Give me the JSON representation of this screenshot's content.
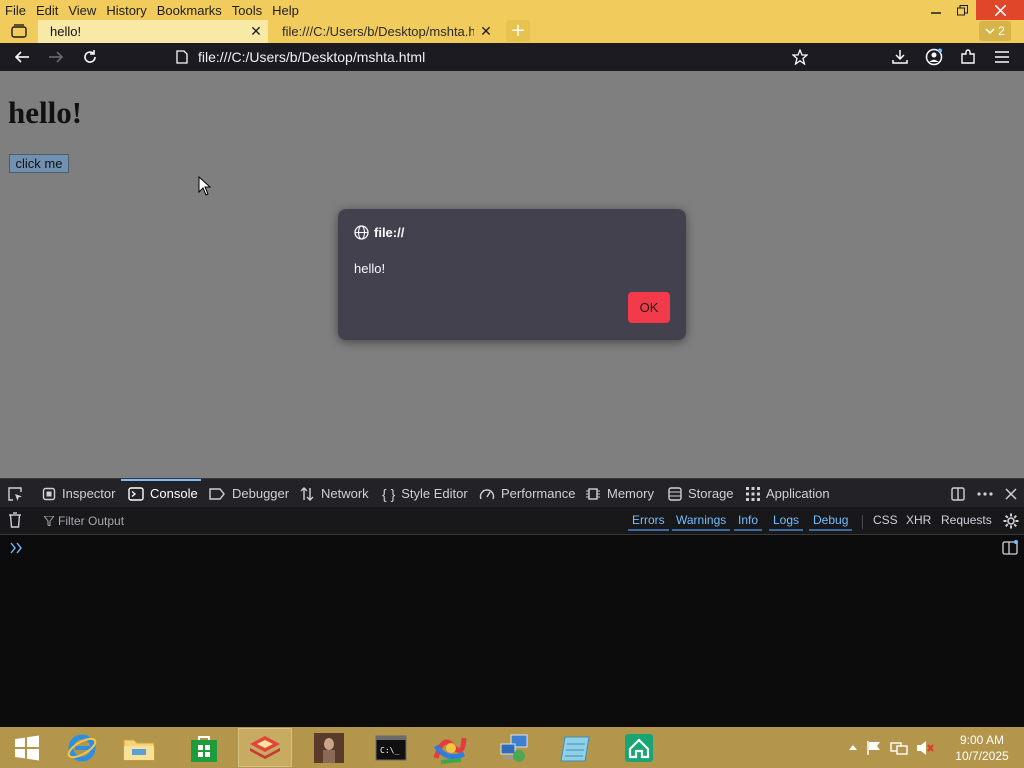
{
  "browser": {
    "menu": [
      "File",
      "Edit",
      "View",
      "History",
      "Bookmarks",
      "Tools",
      "Help"
    ],
    "tabs": [
      {
        "label": "hello!",
        "active": true
      },
      {
        "label": "file:///C:/Users/b/Desktop/mshta.ht",
        "active": false
      }
    ],
    "tab_count": "2",
    "url": "file:///C:/Users/b/Desktop/mshta.html"
  },
  "page": {
    "heading": "hello!",
    "button_label": "click me"
  },
  "dialog": {
    "origin": "file://",
    "message": "hello!",
    "ok_label": "OK"
  },
  "devtools": {
    "tabs": [
      "Inspector",
      "Console",
      "Debugger",
      "Network",
      "Style Editor",
      "Performance",
      "Memory",
      "Storage",
      "Application"
    ],
    "selected_tab": "Console",
    "filter_placeholder": "Filter Output",
    "levels": [
      "Errors",
      "Warnings",
      "Info",
      "Logs",
      "Debug"
    ],
    "types": [
      "CSS",
      "XHR",
      "Requests"
    ]
  },
  "taskbar": {
    "time": "9:00 AM",
    "date": "10/7/2025"
  },
  "colors": {
    "title_bar": "#f1cc5c",
    "devtools_accent": "#75bfff",
    "dialog_ok": "#f23a4b",
    "taskbar": "#b3964c"
  }
}
